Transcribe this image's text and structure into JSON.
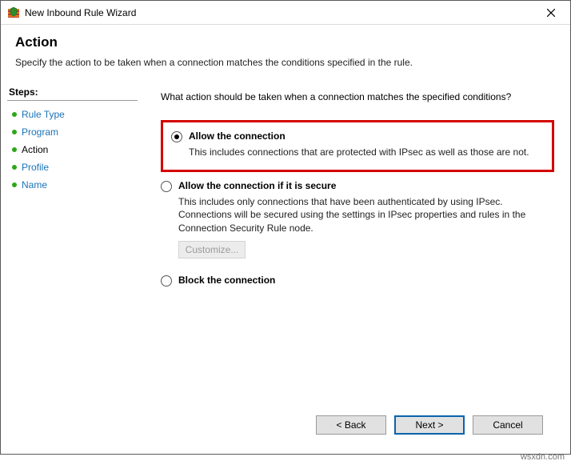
{
  "window": {
    "title": "New Inbound Rule Wizard"
  },
  "header": {
    "title": "Action",
    "subtitle": "Specify the action to be taken when a connection matches the conditions specified in the rule."
  },
  "steps": {
    "heading": "Steps:",
    "items": [
      {
        "label": "Rule Type",
        "current": false
      },
      {
        "label": "Program",
        "current": false
      },
      {
        "label": "Action",
        "current": true
      },
      {
        "label": "Profile",
        "current": false
      },
      {
        "label": "Name",
        "current": false
      }
    ]
  },
  "content": {
    "question": "What action should be taken when a connection matches the specified conditions?",
    "options": [
      {
        "label": "Allow the connection",
        "desc": "This includes connections that are protected with IPsec as well as those are not.",
        "checked": true,
        "highlighted": true
      },
      {
        "label": "Allow the connection if it is secure",
        "desc": "This includes only connections that have been authenticated by using IPsec. Connections will be secured using the settings in IPsec properties and rules in the Connection Security Rule node.",
        "checked": false,
        "customize_label": "Customize..."
      },
      {
        "label": "Block the connection",
        "checked": false
      }
    ]
  },
  "footer": {
    "back": "< Back",
    "next": "Next >",
    "cancel": "Cancel"
  },
  "watermark": "wsxdn.com"
}
